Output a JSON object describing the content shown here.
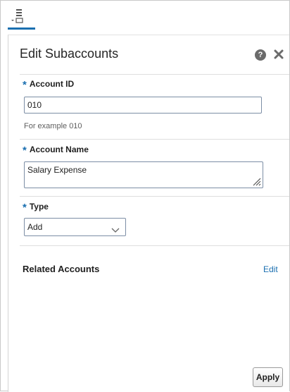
{
  "toolbar": {
    "task_icon": "task-list-icon",
    "accent_color": "#1a6fb0"
  },
  "panel": {
    "title": "Edit Subaccounts",
    "help_icon": "help-icon",
    "help_glyph": "?",
    "close_icon": "close-icon"
  },
  "fields": {
    "required_mark": "*",
    "account_id": {
      "label": "Account ID",
      "value": "010",
      "hint": "For example 010"
    },
    "account_name": {
      "label": "Account Name",
      "value": "Salary Expense"
    },
    "type": {
      "label": "Type",
      "selected": "Add",
      "dropdown_icon": "chevron-down-icon"
    }
  },
  "related": {
    "title": "Related Accounts",
    "edit_label": "Edit"
  },
  "footer": {
    "apply_label": "Apply"
  }
}
